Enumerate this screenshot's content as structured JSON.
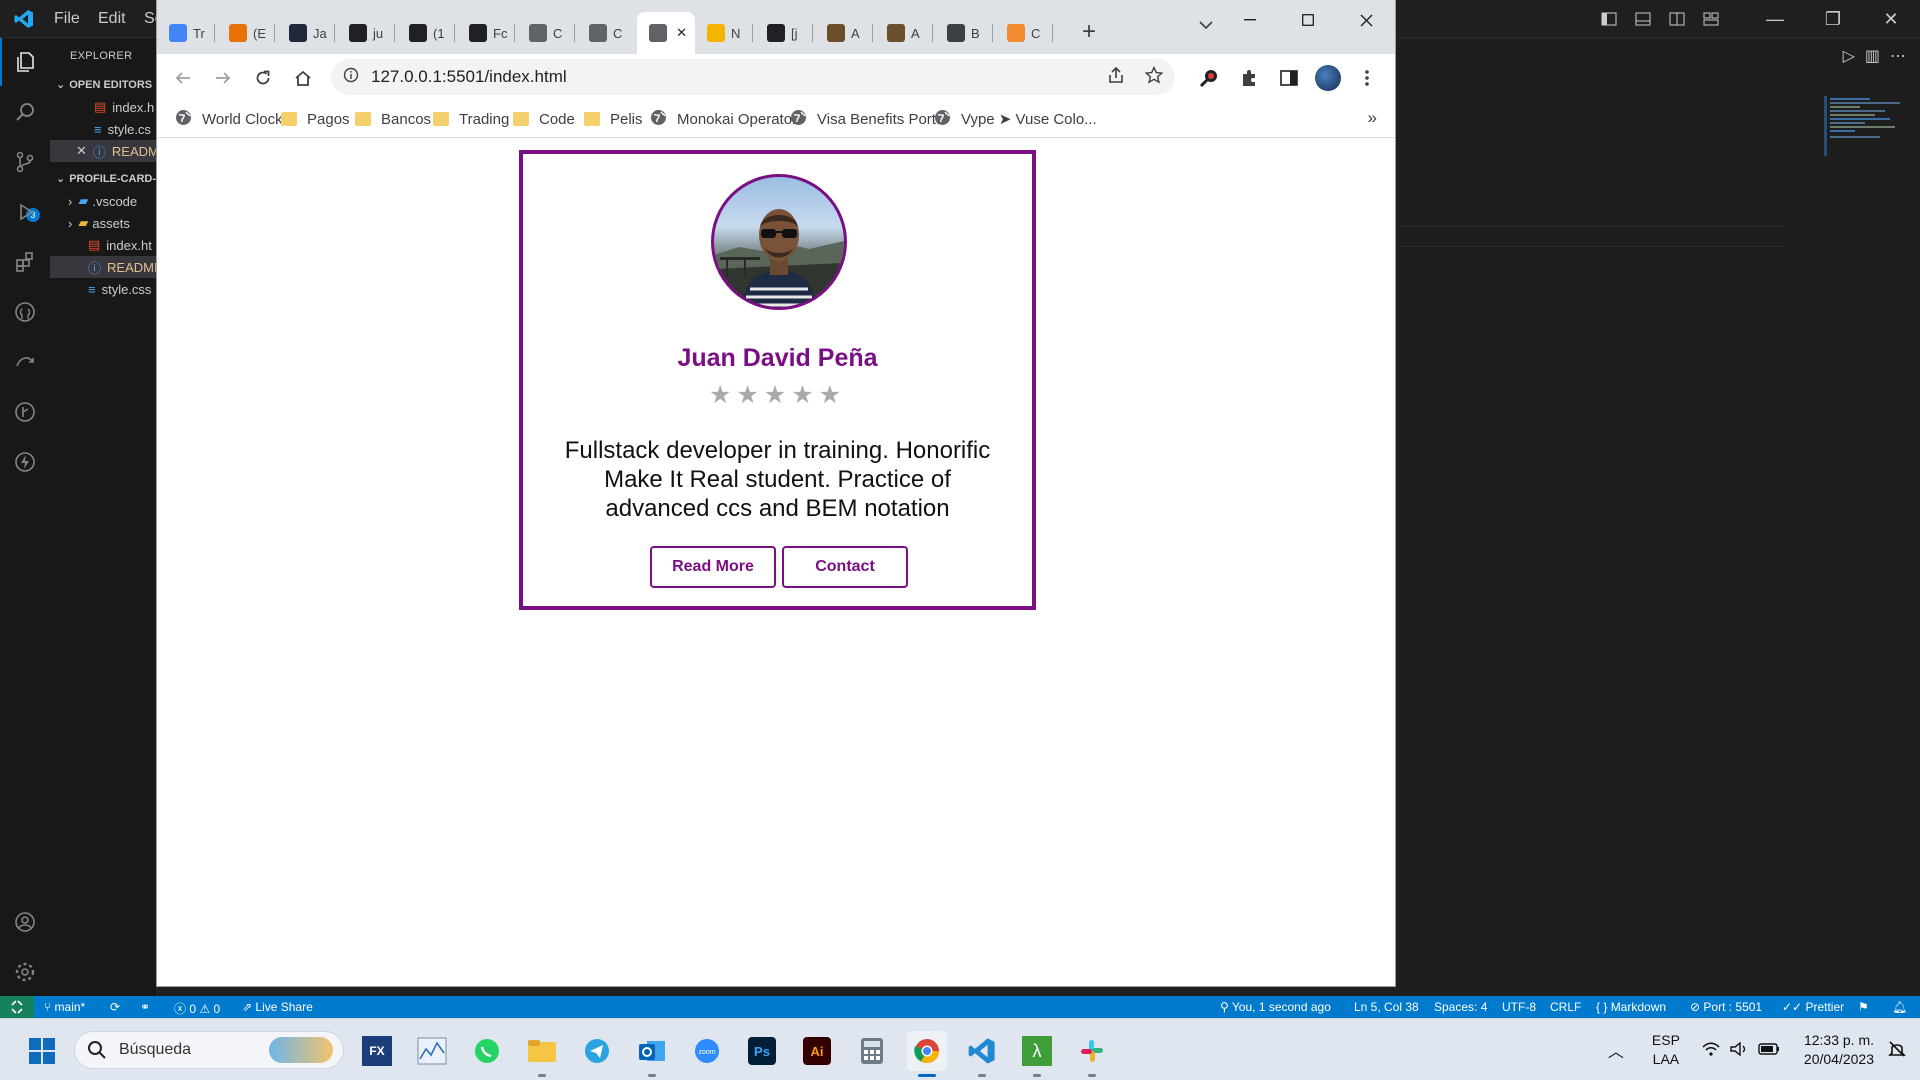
{
  "vscode": {
    "menu": [
      "File",
      "Edit",
      "Se"
    ],
    "sidebar": {
      "header": "EXPLORER",
      "open_editors_title": "OPEN EDITORS",
      "open_editors": [
        "index.h",
        "style.cs",
        "READM"
      ],
      "project_title": "PROFILE-CARD-",
      "tree": [
        ".vscode",
        "assets",
        "index.ht",
        "READMI",
        "style.css"
      ],
      "scm_badge": "3"
    },
    "status": {
      "branch": "main*",
      "problems": "0",
      "warnings": "0",
      "live_share": "Live Share",
      "blame": "You, 1 second ago",
      "cursor": "Ln 5, Col 38",
      "spaces": "Spaces: 4",
      "encoding": "UTF-8",
      "eol": "CRLF",
      "language": "Markdown",
      "port": "Port : 5501",
      "prettier": "Prettier"
    }
  },
  "chrome": {
    "tabs": [
      {
        "label": "Tr",
        "icon": "translate-icon",
        "color": "#4285f4"
      },
      {
        "label": "(E",
        "icon": "codepen-icon",
        "color": "#e8710a"
      },
      {
        "label": "Ja",
        "icon": "code-icon",
        "color": "#1f2937"
      },
      {
        "label": "ju",
        "icon": "github-icon",
        "color": "#202124"
      },
      {
        "label": "(1",
        "icon": "medium-icon",
        "color": "#202124"
      },
      {
        "label": "Fc",
        "icon": "medium-icon",
        "color": "#202124"
      },
      {
        "label": "C",
        "icon": "globe-icon",
        "color": "#5f6368"
      },
      {
        "label": "C",
        "icon": "globe-icon",
        "color": "#5f6368"
      },
      {
        "label": "",
        "icon": "globe-icon",
        "color": "#5f6368",
        "active": true
      },
      {
        "label": "N",
        "icon": "hexagon-icon",
        "color": "#f4b400"
      },
      {
        "label": "[j",
        "icon": "github-icon",
        "color": "#202124"
      },
      {
        "label": "A",
        "icon": "book-icon",
        "color": "#6b4f2a"
      },
      {
        "label": "A",
        "icon": "book-icon",
        "color": "#6b4f2a"
      },
      {
        "label": "B",
        "icon": "chart-icon",
        "color": "#3c4043"
      },
      {
        "label": "C",
        "icon": "w3-icon",
        "color": "#f28b30"
      }
    ],
    "url": "127.0.0.1:5501/index.html",
    "bookmarks": [
      {
        "label": "World Clock",
        "type": "globe"
      },
      {
        "label": "Pagos",
        "type": "folder"
      },
      {
        "label": "Bancos",
        "type": "folder"
      },
      {
        "label": "Trading",
        "type": "folder"
      },
      {
        "label": "Code",
        "type": "folder"
      },
      {
        "label": "Pelis",
        "type": "folder"
      },
      {
        "label": "Monokai Operator",
        "type": "globe"
      },
      {
        "label": "Visa Benefits Portal",
        "type": "globe"
      },
      {
        "label": "Vype ➤ Vuse Colo...",
        "type": "globe"
      }
    ],
    "bookmarks_more": "»"
  },
  "page": {
    "name": "Juan David Peña",
    "stars": "★★★★★",
    "rating": 0,
    "rating_max": 5,
    "description": "Fullstack developer in training. Honorific Make It Real student. Practice of advanced ccs and BEM notation",
    "read_more": "Read More",
    "contact": "Contact",
    "accent": "#7a0f84"
  },
  "taskbar": {
    "search_placeholder": "Búsqueda",
    "lang1": "ESP",
    "lang2": "LAA",
    "time": "12:33 p. m.",
    "date": "20/04/2023"
  }
}
